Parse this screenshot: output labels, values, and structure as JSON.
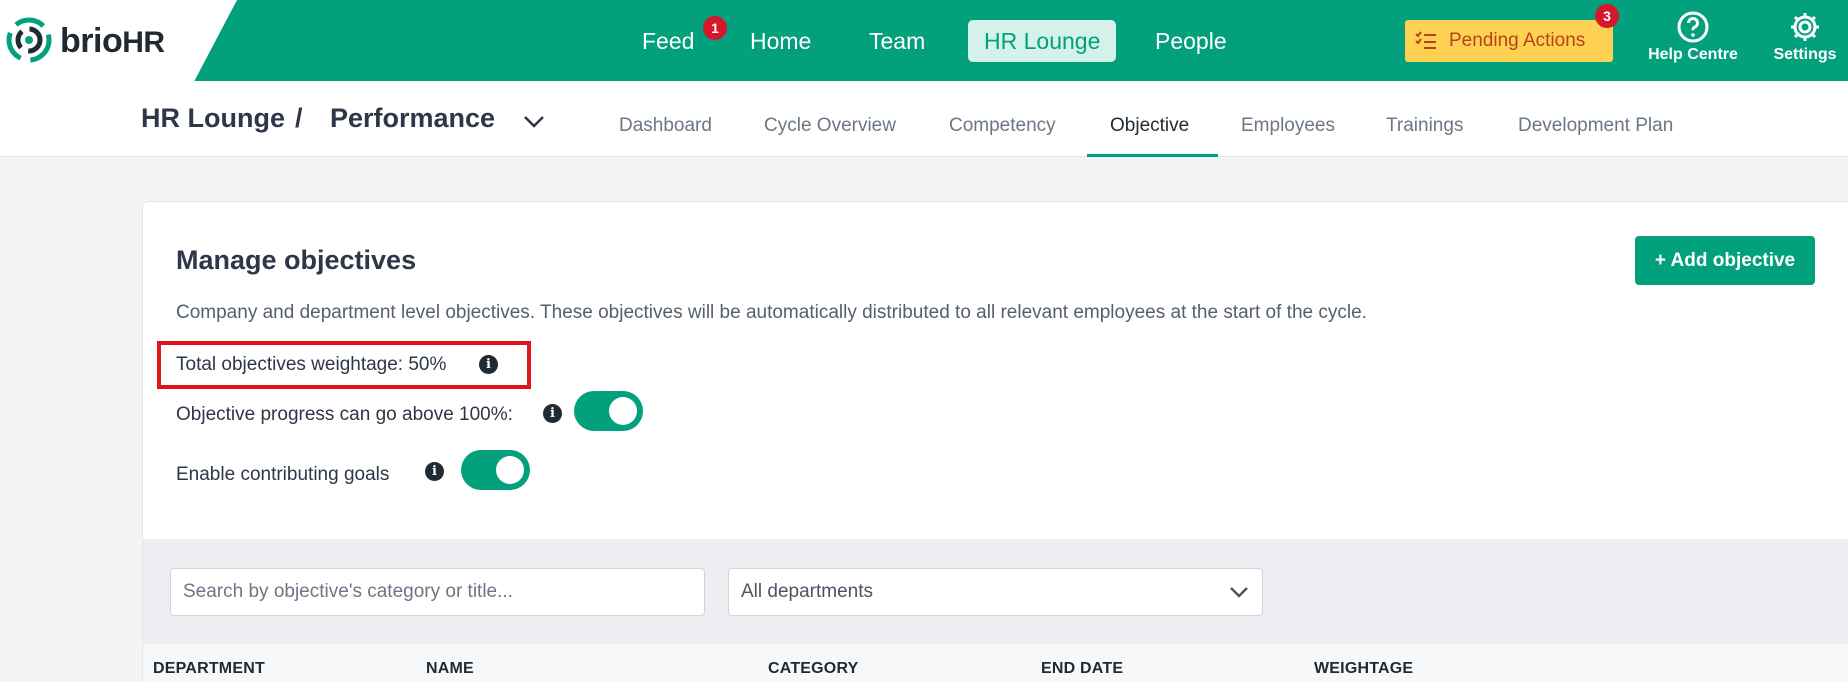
{
  "brand": {
    "name": "brio",
    "suffix": "HR"
  },
  "nav": {
    "items": [
      {
        "label": "Feed",
        "badge": "1"
      },
      {
        "label": "Home"
      },
      {
        "label": "Team"
      },
      {
        "label": "HR Lounge",
        "active": true
      },
      {
        "label": "People"
      }
    ],
    "pending": {
      "label": "Pending Actions",
      "badge": "3"
    },
    "help_label": "Help Centre",
    "settings_label": "Settings"
  },
  "breadcrumb": {
    "root": "HR Lounge",
    "separator": "/",
    "current": "Performance"
  },
  "tabs": [
    {
      "label": "Dashboard"
    },
    {
      "label": "Cycle Overview"
    },
    {
      "label": "Competency"
    },
    {
      "label": "Objective",
      "active": true
    },
    {
      "label": "Employees"
    },
    {
      "label": "Trainings"
    },
    {
      "label": "Development Plan"
    }
  ],
  "manage": {
    "title": "Manage objectives",
    "add_label": "+ Add objective",
    "description": "Company and department level objectives. These objectives will be automatically distributed to all relevant employees at the start of the cycle.",
    "weightage_label": "Total objectives weightage: 50%",
    "progress_label": "Objective progress can go above 100%:",
    "progress_enabled": true,
    "contributing_label": "Enable contributing goals",
    "contributing_enabled": true
  },
  "filters": {
    "search_placeholder": "Search by objective's category or title...",
    "department_value": "All departments"
  },
  "table": {
    "columns": [
      "DEPARTMENT",
      "NAME",
      "CATEGORY",
      "END DATE",
      "WEIGHTAGE"
    ]
  },
  "colors": {
    "brand": "#03a07e",
    "pending": "#ffd152",
    "badge": "#d6172a",
    "highlight": "#e0141e"
  }
}
